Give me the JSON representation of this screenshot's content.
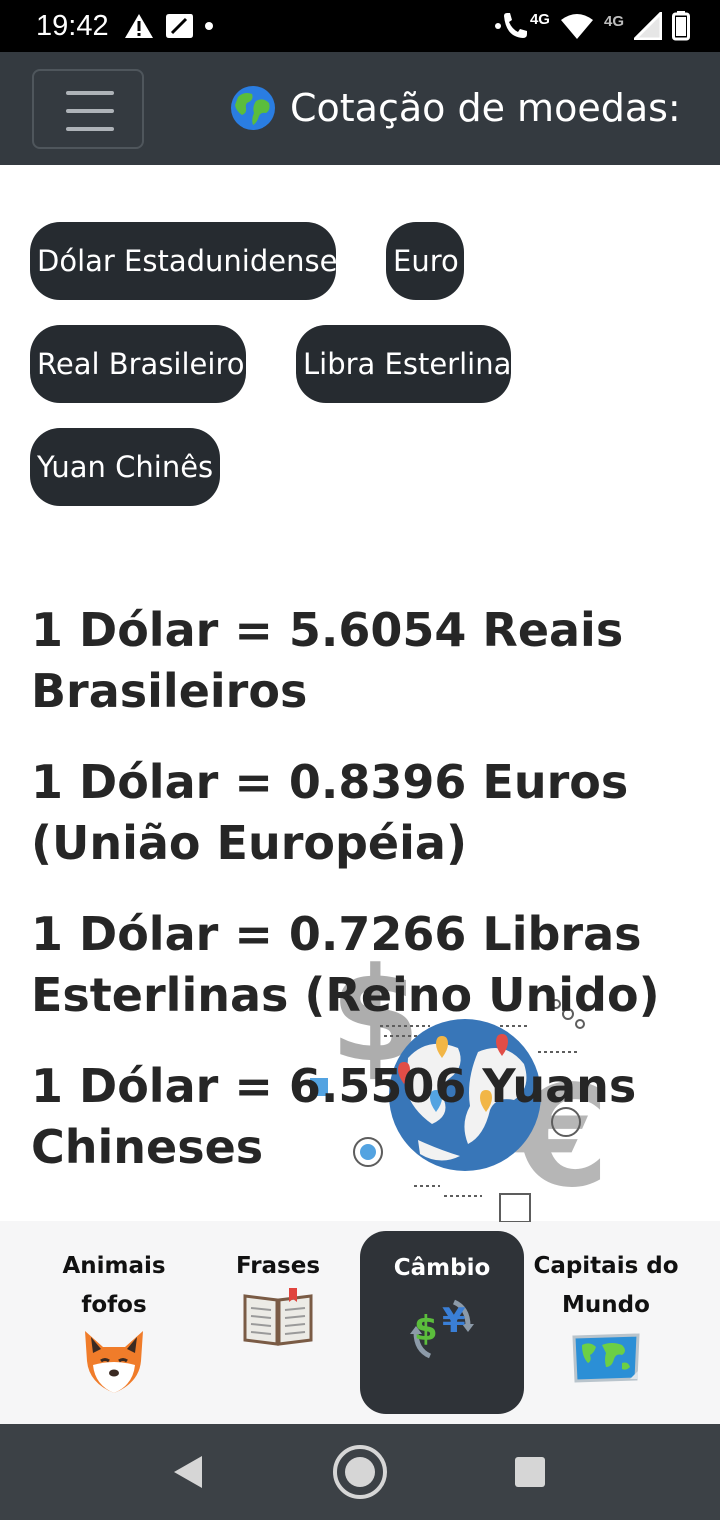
{
  "status_bar": {
    "time": "19:42",
    "network_label_1": "4G",
    "network_label_2": "4G",
    "icons": [
      "warning-icon",
      "sim-card-icon",
      "dot-icon",
      "call-icon",
      "wifi-icon",
      "signal-icon",
      "battery-icon"
    ]
  },
  "header": {
    "menu_icon": "hamburger-menu-icon",
    "globe_icon": "globe-icon",
    "title": "Cotação de moedas:"
  },
  "currencies": [
    {
      "label": "Dólar Estadunidense"
    },
    {
      "label": "Euro"
    },
    {
      "label": "Real Brasileiro"
    },
    {
      "label": "Libra Esterlina"
    },
    {
      "label": "Yuan Chinês"
    }
  ],
  "rates": [
    {
      "text": "1 Dólar = 5.6054 Reais Brasileiros"
    },
    {
      "text": "1 Dólar = 0.8396 Euros (União Européia)"
    },
    {
      "text": "1 Dólar = 0.7266 Libras Esterlinas (Reino Unido)"
    },
    {
      "text": "1 Dólar = 6.5506 Yuans Chineses"
    }
  ],
  "illustration": {
    "icons": [
      "dollar-sign-icon",
      "euro-sign-icon",
      "world-globe-icon",
      "map-pin-icon"
    ]
  },
  "tabs": [
    {
      "label": "Animais fofos",
      "icon": "fox-icon",
      "active": false
    },
    {
      "label": "Frases",
      "icon": "book-icon",
      "active": false
    },
    {
      "label": "Câmbio",
      "icon": "currency-exchange-icon",
      "active": true
    },
    {
      "label": "Capitais do Mundo",
      "icon": "world-map-icon",
      "active": false
    }
  ],
  "nav_bar": {
    "icons": [
      "back-icon",
      "home-icon",
      "recents-icon"
    ]
  },
  "colors": {
    "header_bg": "#343a40",
    "chip_bg": "#262b30",
    "active_tab_bg": "#2f3338",
    "status_bar_bg": "#000000",
    "nav_bar_bg": "#3c4146"
  }
}
